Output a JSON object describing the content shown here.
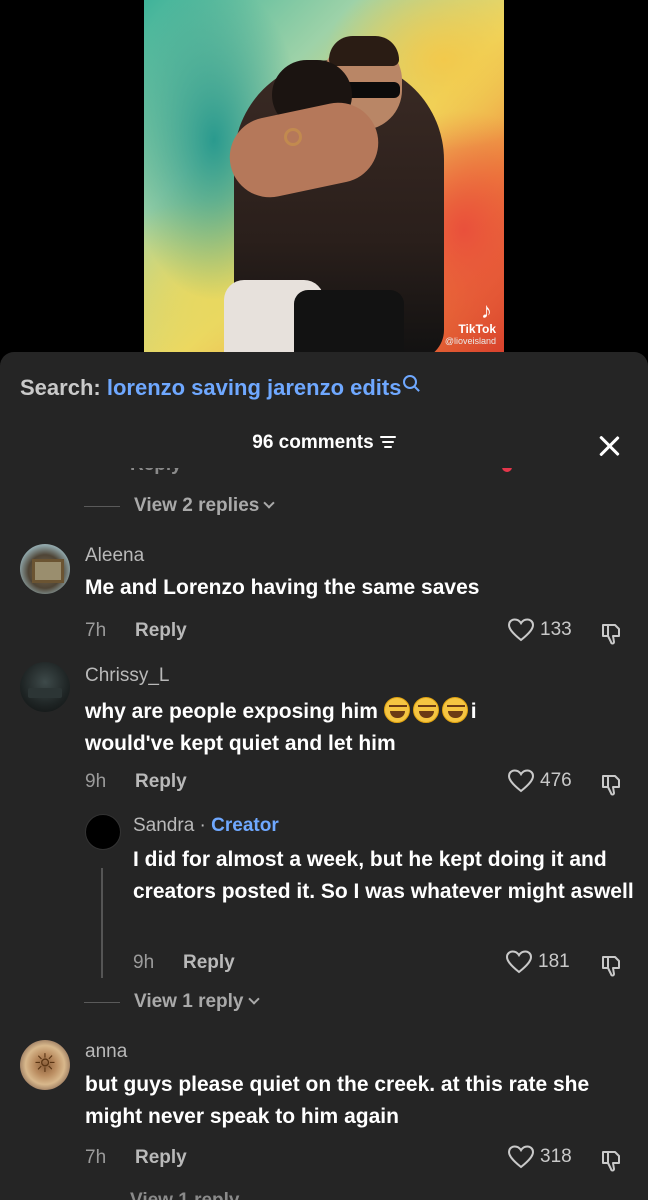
{
  "video": {
    "watermark_brand": "TikTok",
    "watermark_handle": "@lioveisland"
  },
  "search": {
    "prefix": "Search:",
    "query": "lorenzo saving jarenzo edits"
  },
  "comments_panel": {
    "count_label": "96 comments",
    "colors": {
      "background": "#252525",
      "link": "#6fa8ff",
      "like_red": "#e5364b"
    }
  },
  "replies_links": {
    "top": "View 2 replies",
    "middle": "View 1 reply"
  },
  "comments": [
    {
      "username": "Aleena",
      "text": "Me and Lorenzo having the same saves",
      "time": "7h",
      "reply_label": "Reply",
      "likes": "133"
    },
    {
      "username": "Chrissy_L",
      "text_line1": "why are people exposing him",
      "text_line1_suffix": "i",
      "text_line2": "would've kept quiet and let him",
      "emoji": "rolling-on-floor-laughing x3",
      "time": "9h",
      "reply_label": "Reply",
      "likes": "476"
    },
    {
      "username": "Sandra",
      "creator_badge": "Creator",
      "text": "I did for almost a week, but he kept doing it and creators posted it. So I was whatever might aswell",
      "time": "9h",
      "reply_label": "Reply",
      "likes": "181"
    },
    {
      "username": "anna",
      "text": "but guys please quiet on the creek. at this rate she might never speak to him again",
      "time": "7h",
      "reply_label": "Reply",
      "likes": "318"
    }
  ]
}
